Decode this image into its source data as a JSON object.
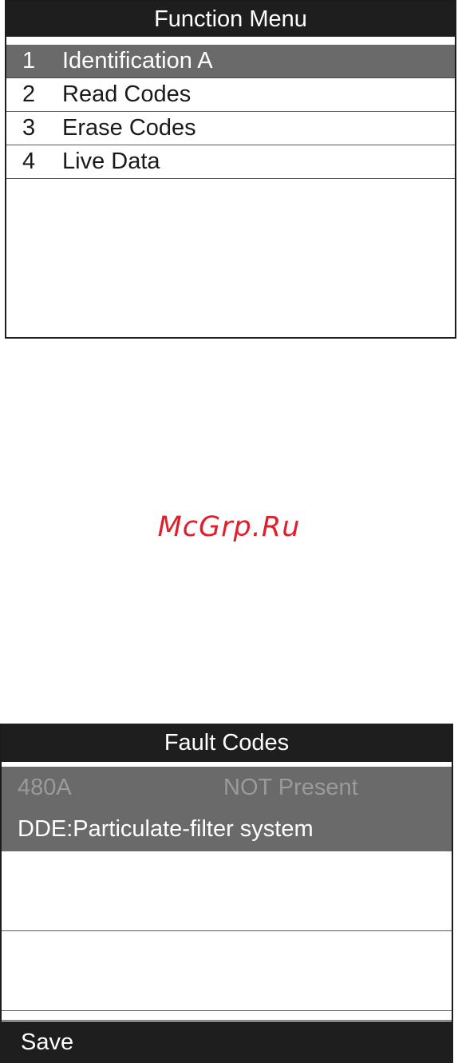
{
  "function_menu": {
    "title": "Function Menu",
    "items": [
      {
        "number": "1",
        "label": "Identification A",
        "selected": true
      },
      {
        "number": "2",
        "label": "Read Codes",
        "selected": false
      },
      {
        "number": "3",
        "label": "Erase Codes",
        "selected": false
      },
      {
        "number": "4",
        "label": "Live Data",
        "selected": false
      }
    ]
  },
  "watermark": "McGrp.Ru",
  "fault_codes": {
    "title": "Fault Codes",
    "codes": [
      {
        "code": "480A",
        "status": "NOT Present",
        "description": "DDE:Particulate-filter system"
      }
    ],
    "footer_button": "Save"
  },
  "colors": {
    "title_bar": "#1e1e1e",
    "selected_row": "#6a6a6a",
    "watermark": "#e11f2a"
  }
}
